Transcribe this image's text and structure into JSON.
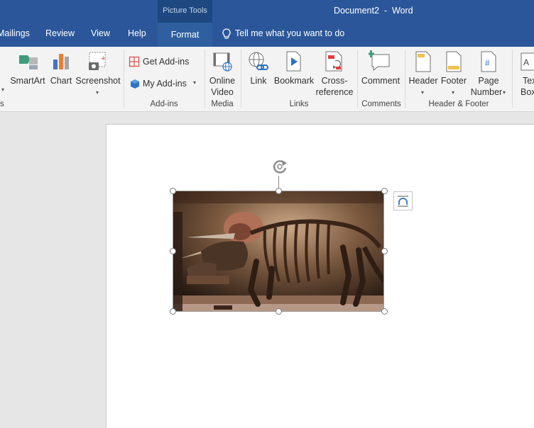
{
  "titlebar": {
    "context_label": "Picture Tools",
    "document_title": "Document2  -  Word"
  },
  "tabs": {
    "mailings": "Mailings",
    "review": "Review",
    "view": "View",
    "help": "Help",
    "format": "Format",
    "tell_me": "Tell me what you want to do"
  },
  "ribbon": {
    "smartart": "SmartArt",
    "chart": "Chart",
    "screenshot": "Screenshot",
    "get_addins": "Get Add-ins",
    "my_addins": "My Add-ins",
    "online_video_1": "Online",
    "online_video_2": "Video",
    "link": "Link",
    "bookmark": "Bookmark",
    "crossref_1": "Cross-",
    "crossref_2": "reference",
    "comment": "Comment",
    "header": "Header",
    "footer": "Footer",
    "page_number_1": "Page",
    "page_number_2": "Number",
    "textbox_1": "Text",
    "textbox_2": "Box",
    "groups": {
      "illustrations_partial": "s",
      "addins": "Add-ins",
      "media": "Media",
      "links": "Links",
      "comments": "Comments",
      "header_footer": "Header & Footer"
    }
  },
  "colors": {
    "titlebar": "#2b579a",
    "ribbon_bg": "#f3f3f3",
    "page_bg": "#ffffff",
    "canvas_bg": "#e6e6e6"
  },
  "icons": {
    "rotate": "rotate-handle-icon",
    "layout_options": "layout-options-icon"
  }
}
